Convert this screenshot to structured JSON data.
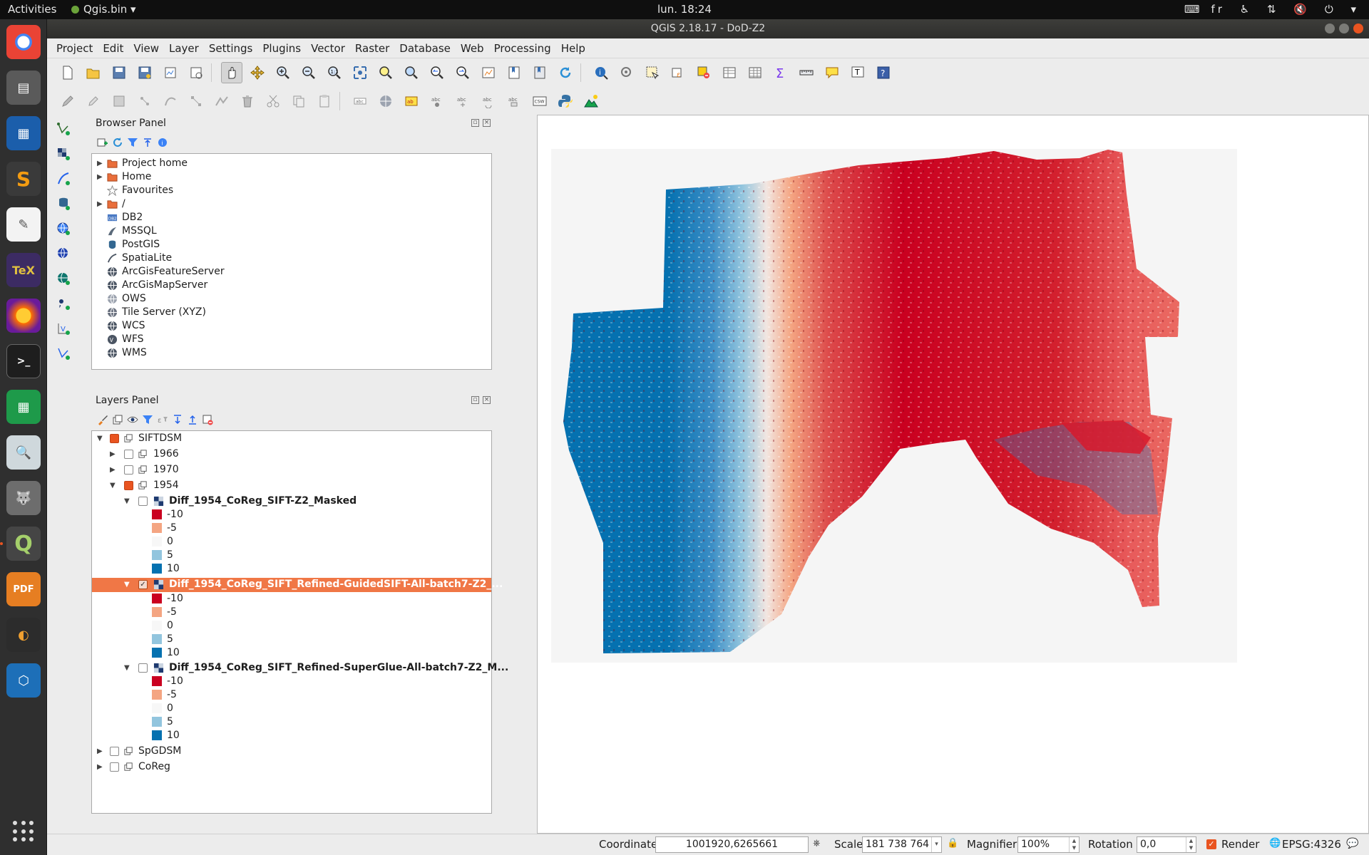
{
  "topbar": {
    "activities": "Activities",
    "app_name": "Qgis.bin",
    "clock": "lun. 18:24",
    "keyboard": "fr"
  },
  "window": {
    "title": "QGIS 2.18.17 - DoD-Z2"
  },
  "menubar": [
    "Project",
    "Edit",
    "View",
    "Layer",
    "Settings",
    "Plugins",
    "Vector",
    "Raster",
    "Database",
    "Web",
    "Processing",
    "Help"
  ],
  "browser": {
    "title": "Browser Panel",
    "items": [
      {
        "label": "Project home",
        "icon": "folder-icon",
        "expandable": true
      },
      {
        "label": "Home",
        "icon": "folder-icon",
        "expandable": true
      },
      {
        "label": "Favourites",
        "icon": "star-icon",
        "expandable": false
      },
      {
        "label": "/",
        "icon": "folder-icon",
        "expandable": true
      },
      {
        "label": "DB2",
        "icon": "db2-icon",
        "expandable": false
      },
      {
        "label": "MSSQL",
        "icon": "mssql-icon",
        "expandable": false
      },
      {
        "label": "PostGIS",
        "icon": "postgis-icon",
        "expandable": false
      },
      {
        "label": "SpatiaLite",
        "icon": "spatialite-icon",
        "expandable": false
      },
      {
        "label": "ArcGisFeatureServer",
        "icon": "arcgis-icon",
        "expandable": false
      },
      {
        "label": "ArcGisMapServer",
        "icon": "arcgis-icon",
        "expandable": false
      },
      {
        "label": "OWS",
        "icon": "globe-icon",
        "expandable": false
      },
      {
        "label": "Tile Server (XYZ)",
        "icon": "globe-icon",
        "expandable": false
      },
      {
        "label": "WCS",
        "icon": "globe-icon",
        "expandable": false
      },
      {
        "label": "WFS",
        "icon": "globe-icon",
        "expandable": false
      },
      {
        "label": "WMS",
        "icon": "globe-icon",
        "expandable": false
      }
    ]
  },
  "layers": {
    "title": "Layers Panel",
    "group_root": "SIFTDSM",
    "groups_years": [
      "1966",
      "1970",
      "1954"
    ],
    "layer_masked": "Diff_1954_CoReg_SIFT-Z2_Masked",
    "layer_guided": "Diff_1954_CoReg_SIFT_Refined-GuidedSIFT-All-batch7-Z2_...",
    "layer_superglue": "Diff_1954_CoReg_SIFT_Refined-SuperGlue-All-batch7-Z2_M...",
    "legend": [
      "-10",
      "-5",
      "0",
      "5",
      "10"
    ],
    "legend_colors": [
      "#ca0020",
      "#f4a582",
      "#f7f7f7",
      "#92c5de",
      "#0571b0"
    ],
    "other_groups": [
      "SpGDSM",
      "CoReg"
    ]
  },
  "statusbar": {
    "coordinate_label": "Coordinate",
    "coordinate_value": "1001920,6265661",
    "scale_label": "Scale",
    "scale_value": "181 738 764",
    "magnifier_label": "Magnifier",
    "magnifier_value": "100%",
    "rotation_label": "Rotation",
    "rotation_value": "0,0",
    "render_label": "Render",
    "crs": "EPSG:4326"
  }
}
